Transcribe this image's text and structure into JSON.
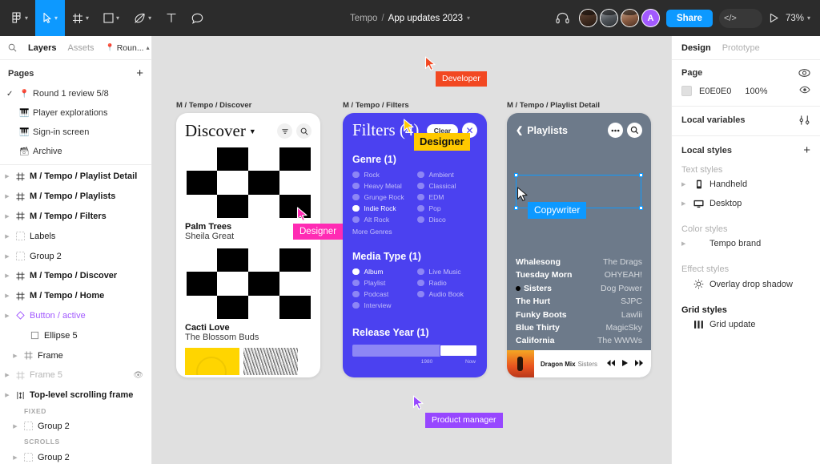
{
  "toolbar": {
    "tools": [
      {
        "name": "figma-menu",
        "icon": "figma-logo",
        "caret": true
      },
      {
        "name": "move",
        "icon": "cursor-arrow",
        "caret": true,
        "active": true
      },
      {
        "name": "frame",
        "icon": "frame-hash",
        "caret": true
      },
      {
        "name": "shape",
        "icon": "square",
        "caret": true
      },
      {
        "name": "pen",
        "icon": "pen-nib",
        "caret": true
      },
      {
        "name": "text",
        "icon": "text-T",
        "caret": false
      },
      {
        "name": "comment",
        "icon": "comment-bubble",
        "caret": false
      }
    ],
    "breadcrumb": {
      "team": "Tempo",
      "separator": "/",
      "file": "App updates 2023"
    },
    "observe_icon": "headphones-icon",
    "share_label": "Share",
    "dev_mode_icon": "code-brackets-icon",
    "present_icon": "play-icon",
    "zoom": "73%",
    "avatar_letter": "A"
  },
  "left_panel": {
    "tabs": [
      {
        "label": "Layers",
        "active": true
      },
      {
        "label": "Assets",
        "active": false
      }
    ],
    "branch": "Roun...",
    "pages_title": "Pages",
    "pages": [
      {
        "label": "Round 1 review 5/8",
        "emoji": "📍",
        "selected": true
      },
      {
        "label": "Player explorations",
        "emoji": "🎹",
        "selected": false
      },
      {
        "label": "Sign-in screen",
        "emoji": "🎹",
        "selected": false
      },
      {
        "label": "Archive",
        "emoji": "🗂",
        "selected": false
      }
    ],
    "layers": [
      {
        "label": "M / Tempo / Playlist Detail",
        "icon": "frame-icon",
        "bold": true,
        "arrow": true
      },
      {
        "label": "M / Tempo / Playlists",
        "icon": "frame-icon",
        "bold": true,
        "arrow": true
      },
      {
        "label": "M / Tempo / Filters",
        "icon": "frame-icon",
        "bold": true,
        "arrow": true
      },
      {
        "label": "Labels",
        "icon": "group-icon",
        "bold": false,
        "arrow": true
      },
      {
        "label": "Group 2",
        "icon": "group-icon",
        "bold": false,
        "arrow": true
      },
      {
        "label": "M / Tempo / Discover",
        "icon": "frame-icon",
        "bold": true,
        "arrow": true
      },
      {
        "label": "M / Tempo / Home",
        "icon": "frame-icon",
        "bold": true,
        "arrow": true
      },
      {
        "label": "Button / active",
        "icon": "component-icon",
        "bold": false,
        "arrow": true,
        "component": true
      },
      {
        "label": "Ellipse 5",
        "icon": "ellipse-icon",
        "bold": false,
        "arrow": false,
        "indent": 2
      },
      {
        "label": "Frame",
        "icon": "frame-icon",
        "bold": false,
        "arrow": true,
        "indent": 1
      },
      {
        "label": "Frame 5",
        "icon": "frame-icon",
        "bold": false,
        "arrow": true,
        "muted": true,
        "eye": true
      },
      {
        "label": "Top-level scrolling frame",
        "icon": "scroll-frame-icon",
        "bold": true,
        "arrow": true
      },
      {
        "label": "FIXED",
        "sublabel": true
      },
      {
        "label": "Group 2",
        "icon": "group-icon",
        "bold": false,
        "arrow": true,
        "indent": 1
      },
      {
        "label": "SCROLLS",
        "sublabel": true
      },
      {
        "label": "Group 2",
        "icon": "group-icon",
        "bold": false,
        "arrow": true,
        "indent": 1
      }
    ]
  },
  "canvas": {
    "frames": [
      {
        "label": "M / Tempo / Discover"
      },
      {
        "label": "M / Tempo / Filters"
      },
      {
        "label": "M / Tempo / Playlist Detail"
      }
    ],
    "discover": {
      "title": "Discover",
      "chevron_icon": "chevron-down-icon",
      "filter_icon": "filter-icon",
      "search_icon": "search-icon",
      "tracks": [
        {
          "title": "Palm Trees",
          "artist": "Sheila Great"
        },
        {
          "title": "Cacti Love",
          "artist": "The Blossom Buds"
        }
      ]
    },
    "filters": {
      "title": "Filters (4)",
      "clear_label": "Clear",
      "close_icon": "close-x-icon",
      "genre_title": "Genre (1)",
      "genre_options": [
        {
          "label": "Rock",
          "selected": false
        },
        {
          "label": "Ambient",
          "selected": false
        },
        {
          "label": "Heavy Metal",
          "selected": false
        },
        {
          "label": "Classical",
          "selected": false
        },
        {
          "label": "Grunge Rock",
          "selected": false
        },
        {
          "label": "EDM",
          "selected": false
        },
        {
          "label": "Indie Rock",
          "selected": true
        },
        {
          "label": "Pop",
          "selected": false
        },
        {
          "label": "Alt Rock",
          "selected": false
        },
        {
          "label": "Disco",
          "selected": false
        }
      ],
      "more_genres": "More Genres",
      "media_title": "Media Type (1)",
      "media_options": [
        {
          "label": "Album",
          "selected": true
        },
        {
          "label": "Live Music",
          "selected": false
        },
        {
          "label": "Playlist",
          "selected": false
        },
        {
          "label": "Radio",
          "selected": false
        },
        {
          "label": "Podcast",
          "selected": false
        },
        {
          "label": "Audio Book",
          "selected": false
        },
        {
          "label": "Interview",
          "selected": false
        }
      ],
      "release_title": "Release Year (1)",
      "slider_min_label": "1980",
      "slider_max_label": "Now"
    },
    "playlist_detail": {
      "back_label": "Playlists",
      "back_icon": "chevron-left-icon",
      "more_icon": "ellipsis-icon",
      "search_icon": "search-icon",
      "songs": [
        {
          "name": "Whalesong",
          "artist": "The Drags",
          "playing": false
        },
        {
          "name": "Tuesday Morn",
          "artist": "OHYEAH!",
          "playing": false
        },
        {
          "name": "Sisters",
          "artist": "Dog Power",
          "playing": true
        },
        {
          "name": "The Hurt",
          "artist": "SJPC",
          "playing": false
        },
        {
          "name": "Funky Boots",
          "artist": "Lawlii",
          "playing": false
        },
        {
          "name": "Blue Thirty",
          "artist": "MagicSky",
          "playing": false
        },
        {
          "name": "California",
          "artist": "The WWWs",
          "playing": false
        }
      ],
      "player": {
        "track": "Dragon Mix",
        "subtitle": "Sisters",
        "prev_icon": "rewind-icon",
        "play_icon": "play-icon",
        "next_icon": "fast-forward-icon"
      }
    },
    "cursors": [
      {
        "label": "Developer",
        "color": "#f24822"
      },
      {
        "label": "Designer",
        "color": "#ffc900"
      },
      {
        "label": "Designer",
        "color": "#ff2bb4"
      },
      {
        "label": "Copywriter",
        "color": "#0d99ff"
      },
      {
        "label": "Product manager",
        "color": "#9747ff"
      }
    ]
  },
  "right_panel": {
    "tabs": [
      {
        "label": "Design",
        "active": true
      },
      {
        "label": "Prototype",
        "active": false
      }
    ],
    "page_title": "Page",
    "page_settings_icon": "page-settings-icon",
    "page_color_hex": "E0E0E0",
    "page_color_opacity": "100%",
    "page_visibility_icon": "eye-icon",
    "local_variables_title": "Local variables",
    "local_variables_icon": "sliders-icon",
    "local_styles_title": "Local styles",
    "local_styles_add_icon": "plus-icon",
    "groups": [
      {
        "title": "Text styles",
        "bold": false,
        "items": [
          {
            "label": "Handheld",
            "icon": "handheld-icon",
            "arrow": true
          },
          {
            "label": "Desktop",
            "icon": "desktop-icon",
            "arrow": true
          }
        ]
      },
      {
        "title": "Color styles",
        "bold": false,
        "items": [
          {
            "label": "Tempo brand",
            "icon": "",
            "arrow": true
          }
        ]
      },
      {
        "title": "Effect styles",
        "bold": false,
        "items": [
          {
            "label": "Overlay drop shadow",
            "icon": "effect-icon",
            "arrow": false
          }
        ]
      },
      {
        "title": "Grid styles",
        "bold": true,
        "items": [
          {
            "label": "Grid update",
            "icon": "grid-icon",
            "arrow": false
          }
        ]
      }
    ]
  }
}
